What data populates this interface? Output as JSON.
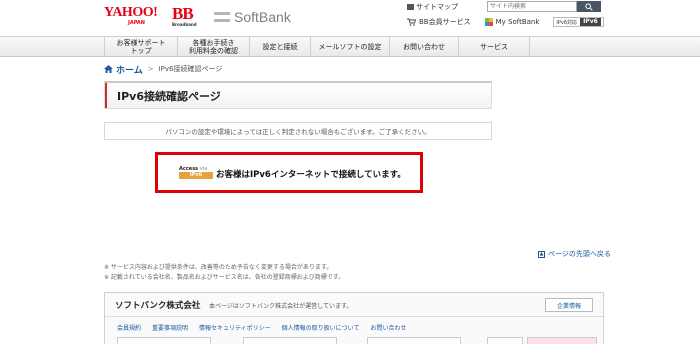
{
  "header": {
    "yahoo_logo_text": "YAHOO!",
    "yahoo_logo_sub": "JAPAN",
    "bb_logo_text": "BB",
    "bb_logo_sub": "Broadband",
    "softbank_logo_text": "SoftBank",
    "sitemap_label": "サイトマップ",
    "search_placeholder": "サイト内検索",
    "bb_member_service": "BB会員サービス",
    "my_softbank": "My SoftBank",
    "ipv6_support_label": "IPv6対応",
    "ipv6_badge": "IPv6"
  },
  "nav": {
    "items": [
      {
        "line1": "お客様サポート",
        "line2": "トップ"
      },
      {
        "line1": "各種お手続き",
        "line2": "利用料金の確認"
      },
      {
        "line1": "設定と接続",
        "line2": ""
      },
      {
        "line1": "メールソフトの設定",
        "line2": ""
      },
      {
        "line1": "お問い合わせ",
        "line2": ""
      },
      {
        "line1": "サービス",
        "line2": ""
      }
    ]
  },
  "breadcrumb": {
    "home": "ホーム",
    "separator": ">",
    "current": "IPv6接続確認ページ"
  },
  "page": {
    "title": "IPv6接続確認ページ",
    "notice": "パソコンの設定や環境によっては正しく判定されない場合もございます。ご了承ください。",
    "access_logo_top": "Access",
    "access_logo_via": "via",
    "access_logo_bottom": "IPv6",
    "result_text": "お客様はIPv6インターネットで接続しています。",
    "result_border_color": "#e10000",
    "page_top": "ページの先頭へ戻る"
  },
  "notes": [
    "※ サービス内容および提供条件は、改善等のため予告なく変更する場合があります。",
    "※ 記載されている会社名、製品名およびサービス名は、各社の登録商標および商標です。"
  ],
  "footer": {
    "corp_name": "ソフトバンク株式会社",
    "corp_desc": "本ページはソフトバンク株式会社が運営しています。",
    "corp_info_button": "企業情報",
    "links": [
      "会員規約",
      "重要事項説明",
      "情報セキュリティポリシー",
      "個人情報の取り扱いについて",
      "お問い合わせ"
    ],
    "banners": [
      "",
      "",
      "",
      "",
      ""
    ]
  },
  "colors": {
    "brand_red": "#e60012",
    "link_blue": "#1a5aa0",
    "access_orange": "#e8a23c"
  }
}
